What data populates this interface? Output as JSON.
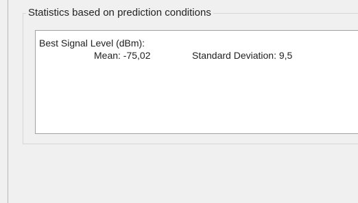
{
  "group": {
    "title": "Statistics based on prediction conditions"
  },
  "statistics": {
    "heading": "Best Signal Level (dBm):",
    "mean": "Mean: -75,02",
    "standard_deviation": "Standard Deviation: 9,5"
  }
}
